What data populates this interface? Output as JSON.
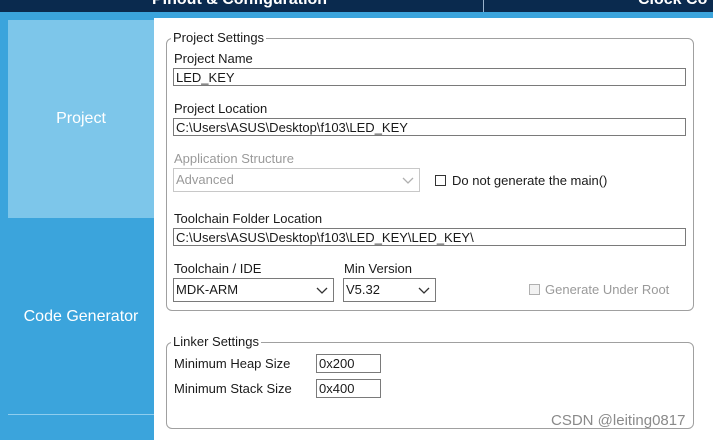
{
  "header": {
    "tabs": [
      {
        "label": "Pinout & Configuration"
      },
      {
        "label": "Clock Co"
      }
    ]
  },
  "sidebar": {
    "items": [
      {
        "label": "Project",
        "active": true
      },
      {
        "label": "Code Generator",
        "active": false
      }
    ]
  },
  "project_settings": {
    "legend": "Project Settings",
    "project_name": {
      "label": "Project Name",
      "value": "LED_KEY"
    },
    "project_location": {
      "label": "Project Location",
      "value": "C:\\Users\\ASUS\\Desktop\\f103\\LED_KEY"
    },
    "application_structure": {
      "label": "Application Structure",
      "value": "Advanced",
      "enabled": false
    },
    "do_not_generate_main": {
      "label": "Do not generate the main()",
      "checked": false
    },
    "toolchain_folder": {
      "label": "Toolchain Folder Location",
      "value": "C:\\Users\\ASUS\\Desktop\\f103\\LED_KEY\\LED_KEY\\"
    },
    "toolchain_ide": {
      "label": "Toolchain / IDE",
      "value": "MDK-ARM"
    },
    "min_version": {
      "label": "Min Version",
      "value": "V5.32"
    },
    "generate_under_root": {
      "label": "Generate Under Root",
      "checked": false,
      "enabled": false
    }
  },
  "linker_settings": {
    "legend": "Linker Settings",
    "min_heap": {
      "label": "Minimum Heap Size",
      "value": "0x200"
    },
    "min_stack": {
      "label": "Minimum Stack Size",
      "value": "0x400"
    }
  },
  "watermark": "CSDN @leiting0817",
  "colors": {
    "header_bg": "#0a2a4e",
    "accent_blue": "#3ba4dc",
    "sidebar_active": "#7dc6ea"
  }
}
